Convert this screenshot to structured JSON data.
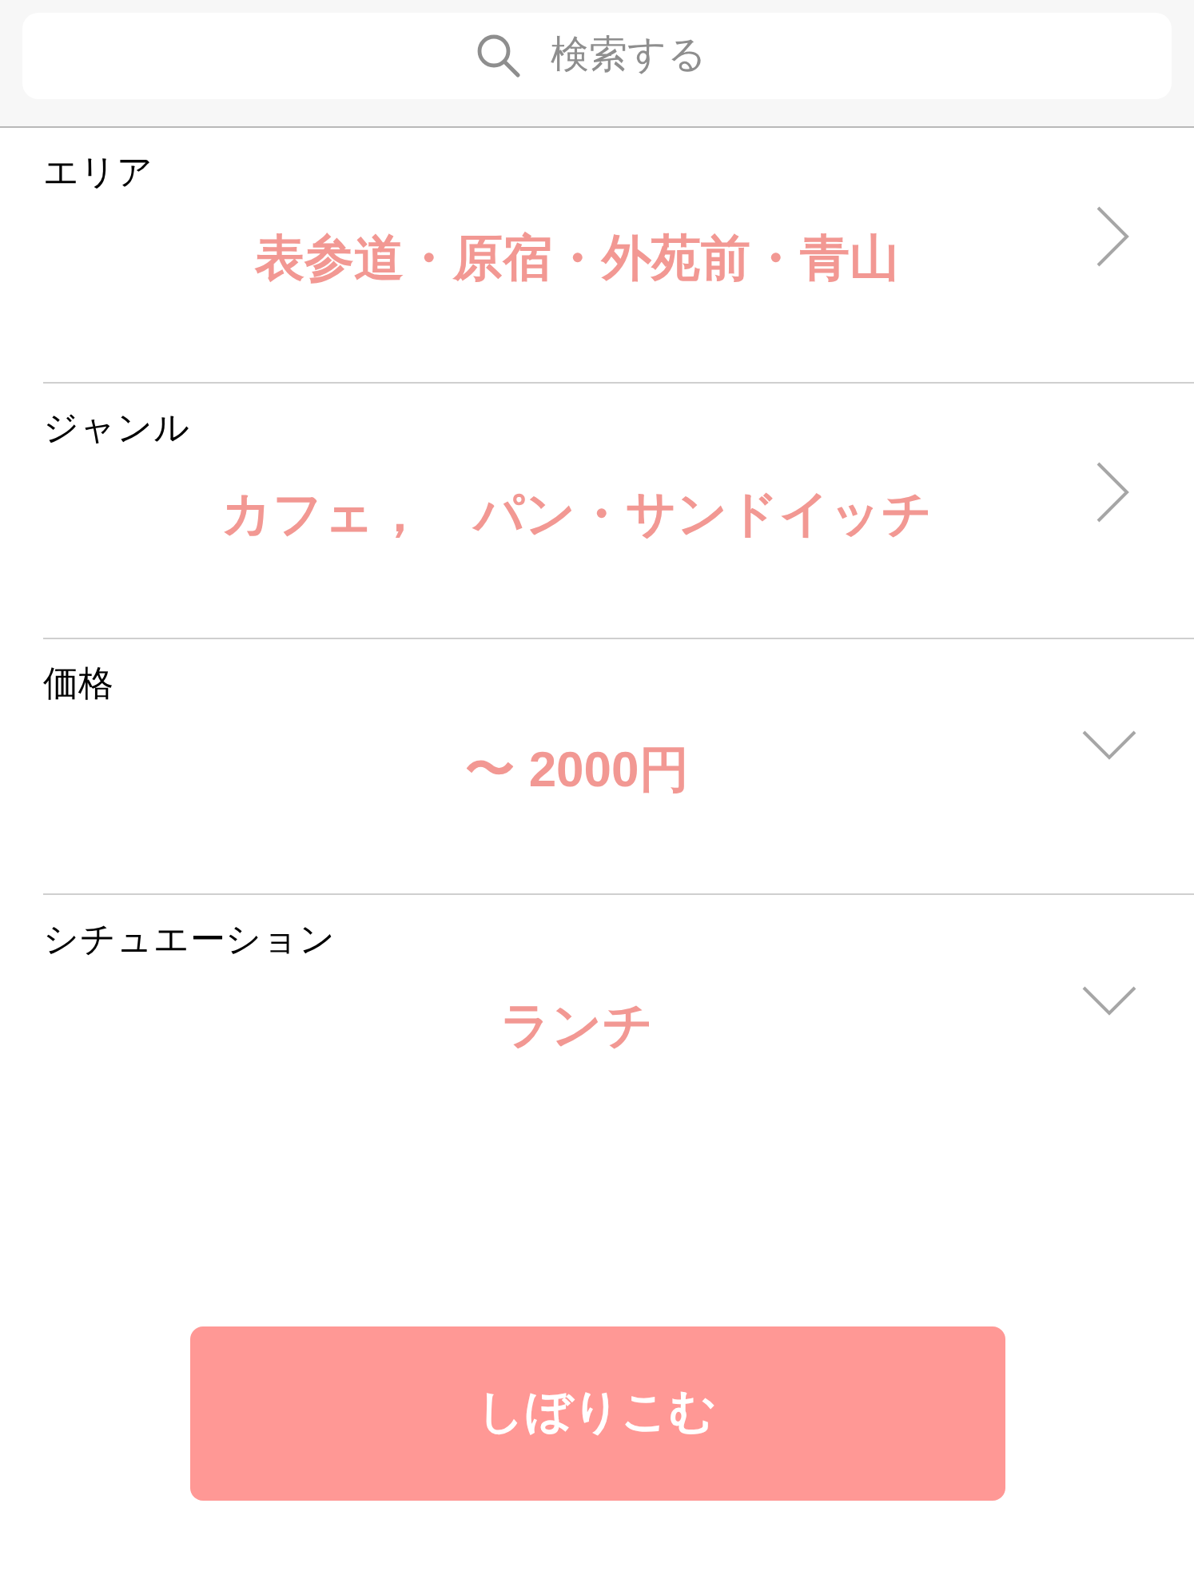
{
  "search": {
    "placeholder": "検索する"
  },
  "filters": [
    {
      "label": "エリア",
      "value": "表参道・原宿・外苑前・青山",
      "kind": "link"
    },
    {
      "label": "ジャンル",
      "value": "カフェ，　パン・サンドイッチ",
      "kind": "link"
    },
    {
      "label": "価格",
      "value": "〜 2000円",
      "kind": "dropdown"
    },
    {
      "label": "シチュエーション",
      "value": "ランチ",
      "kind": "dropdown"
    }
  ],
  "submit": "しぼりこむ"
}
